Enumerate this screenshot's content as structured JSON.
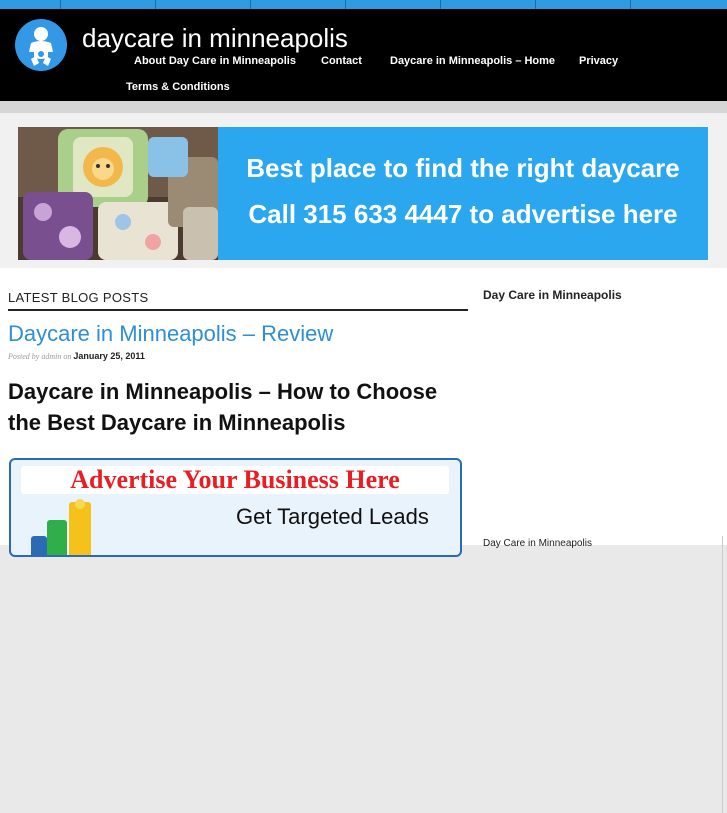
{
  "site": {
    "title": "daycare in minneapolis"
  },
  "nav": {
    "items": [
      {
        "label": "About Day Care in Minneapolis"
      },
      {
        "label": "Contact"
      },
      {
        "label": "Daycare in Minneapolis – Home"
      },
      {
        "label": "Privacy"
      },
      {
        "label": "Terms & Conditions"
      }
    ]
  },
  "banner": {
    "line1": "Best place to find the right daycare",
    "line2": "Call 315 633 4447 to advertise here"
  },
  "main": {
    "section_heading": "LATEST BLOG POSTS",
    "post": {
      "title": "Daycare in Minneapolis – Review",
      "meta_prefix": "Posted by admin on",
      "date": "January 25, 2011",
      "heading": "Daycare in Minneapolis – How to Choose the Best Daycare in Minneapolis"
    },
    "ad": {
      "line1": "Advertise Your Business Here",
      "line2": "Get Targeted Leads"
    }
  },
  "sidebar": {
    "title": "Day Care in Minneapolis",
    "footer_text": "Day Care in Minneapolis"
  },
  "colors": {
    "accent": "#2f9be0",
    "header_bg": "#000000",
    "link": "#2e8fd6",
    "ad_red": "#e81e24"
  }
}
